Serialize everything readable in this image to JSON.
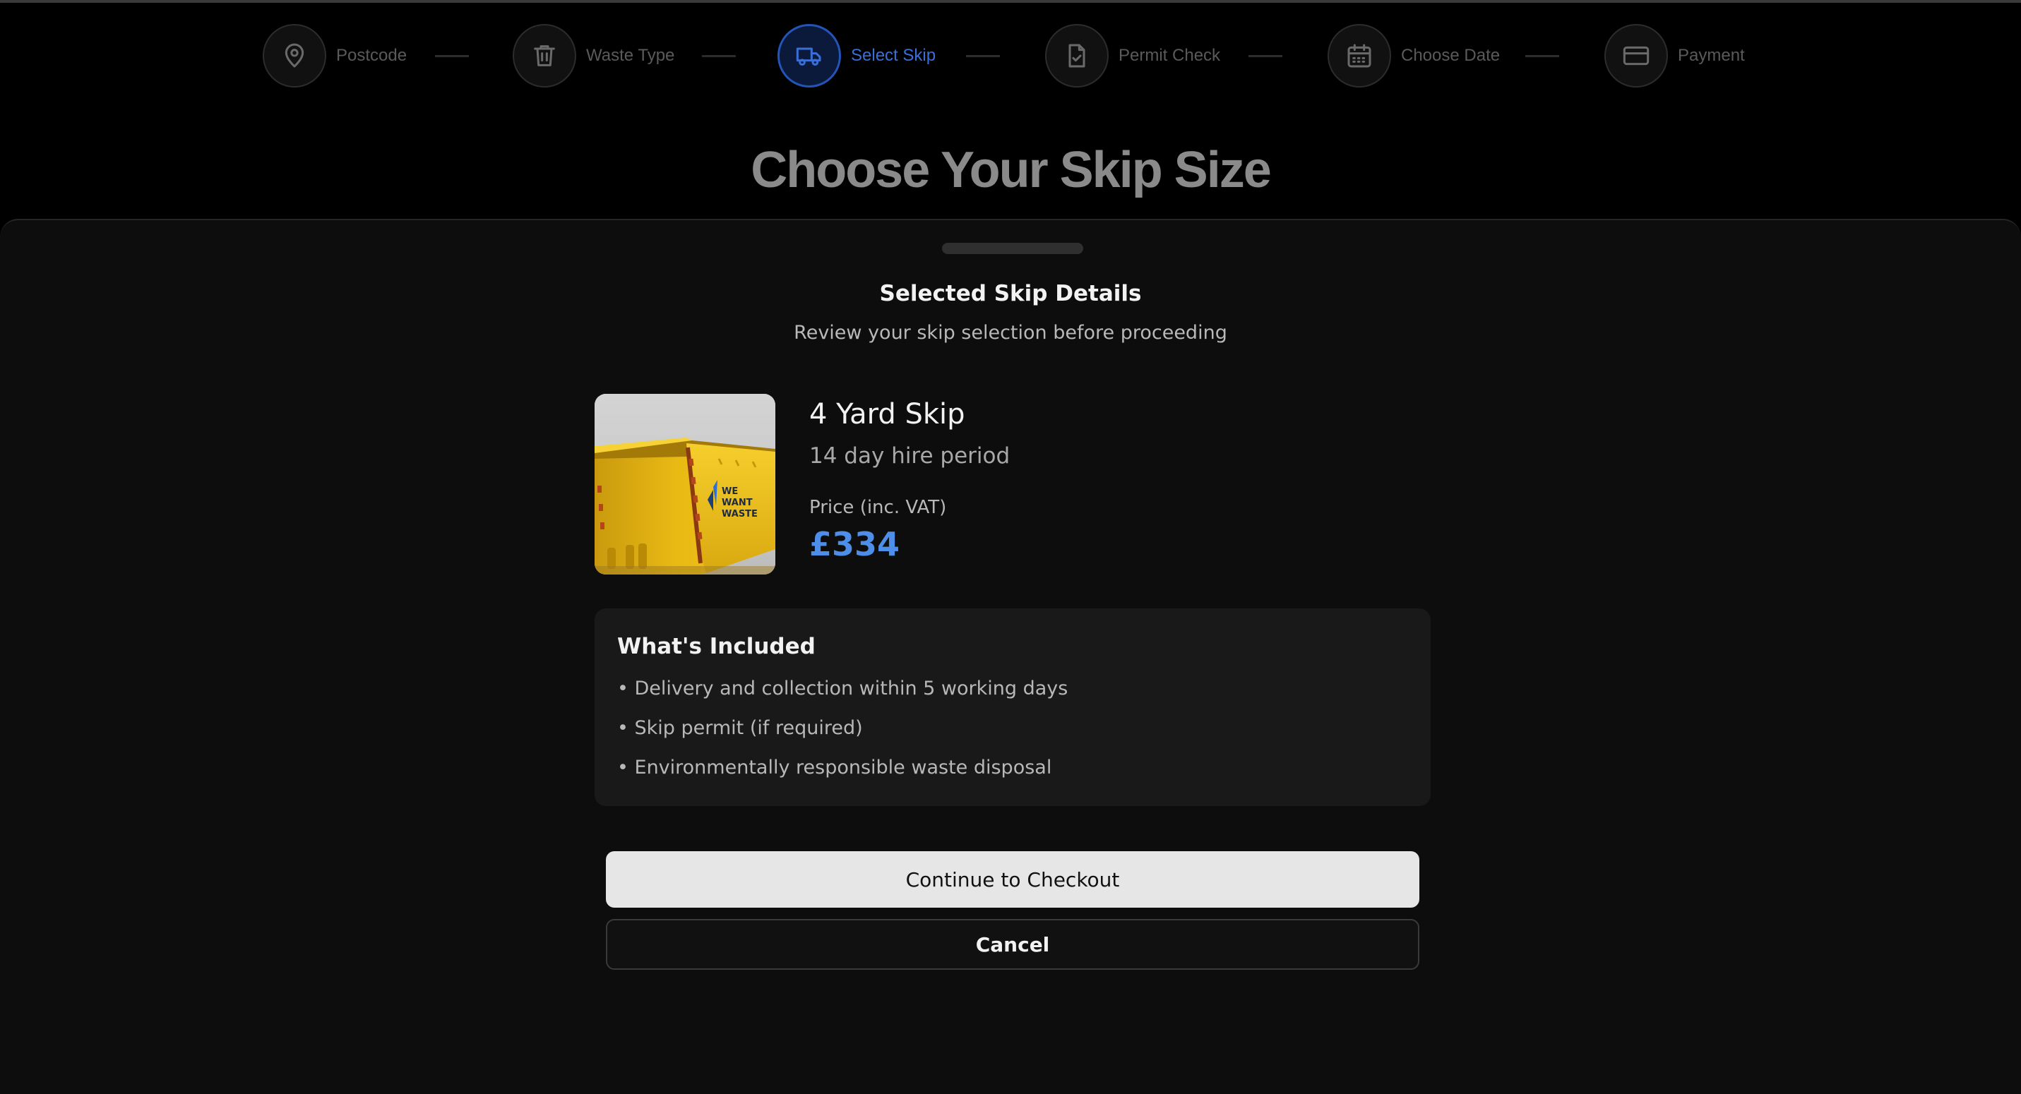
{
  "stepper": {
    "steps": [
      {
        "label": "Postcode",
        "icon": "map-pin-icon"
      },
      {
        "label": "Waste Type",
        "icon": "trash-icon"
      },
      {
        "label": "Select Skip",
        "icon": "truck-icon",
        "active": true
      },
      {
        "label": "Permit Check",
        "icon": "file-check-icon"
      },
      {
        "label": "Choose Date",
        "icon": "calendar-icon"
      },
      {
        "label": "Payment",
        "icon": "credit-card-icon"
      }
    ]
  },
  "page": {
    "title": "Choose Your Skip Size"
  },
  "sheet": {
    "title": "Selected Skip Details",
    "subtitle": "Review your skip selection before proceeding",
    "skip": {
      "name": "4 Yard Skip",
      "period": "14 day hire period",
      "price_label": "Price (inc. VAT)",
      "price": "£334",
      "image_brand_text": "WE WANT WASTE"
    },
    "included": {
      "title": "What's Included",
      "items": [
        "• Delivery and collection within 5 working days",
        "• Skip permit (if required)",
        "• Environmentally responsible waste disposal"
      ]
    },
    "buttons": {
      "continue": "Continue to Checkout",
      "cancel": "Cancel"
    }
  },
  "colors": {
    "accent": "#4d8fe8",
    "active_step": "#3a6fd6",
    "background": "#000000",
    "sheet": "#0d0d0d"
  }
}
